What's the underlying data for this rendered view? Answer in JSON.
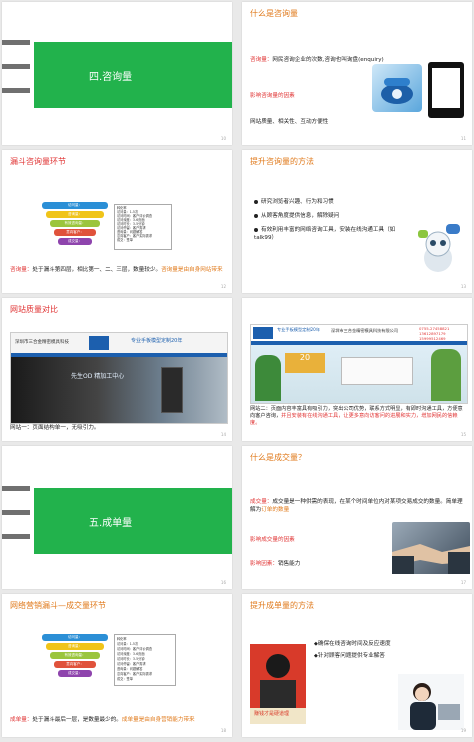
{
  "colors": {
    "orange": "#e07a1c",
    "red": "#e03434",
    "green": "#22b24c"
  },
  "s1": {
    "section": "四.咨询量",
    "page": "10"
  },
  "s2": {
    "title": "什么是咨询量",
    "term": "咨询量：",
    "definition": "网民咨询企业的次数,咨询也叫询盘(enquiry)",
    "factors_title": "影响咨询量的因素",
    "factors": "网站质量、相关性、互动方便性",
    "page": "11"
  },
  "s3": {
    "title": "漏斗咨询量环节",
    "funnel": [
      "访问量：",
      "咨询量：",
      "有效咨询量：",
      "意向客户：",
      "成交量："
    ],
    "legend": [
      "转化率",
      "访问量：1-5次",
      "访问时间：客户评价调查",
      "访问深度：3-6页面",
      "访问时长：3-5分钟",
      "访问停留：客户需求",
      "咨询量：问题解答",
      "意向客户：客户实际需求",
      "成交：签单"
    ],
    "note_red": "咨询量：",
    "note_black": "处于漏斗第四层，相比第一、二、三层，数量较少。",
    "note_orange": "咨询量是由自身网站带来",
    "page": "12"
  },
  "s4": {
    "title": "提升咨询量的方法",
    "items": [
      "研究浏览者兴趣、行为和习惯",
      "从顾客角度提供信息，解除疑问",
      "有效利用丰富的网络咨询工具，安装在线沟通工具（如talk99）"
    ],
    "page": "13"
  },
  "s5": {
    "title": "网站质量对比",
    "company": "深圳市三合金精密模具科技",
    "slogan": "专业手板模型定制20年",
    "banner": "先生OD 精加工中心",
    "caption": "网站一：页面结构单一，无吸引力。",
    "page": "14"
  },
  "s6": {
    "company": "深圳市三合金精密模具科技有限公司",
    "slogan": "专业手板模型定制20年",
    "phone1": "0755-27458821",
    "phone2": "13612897179",
    "phone3": "15999512469",
    "caption_a": "网站二：页面内容丰富具有吸引力，突出公司优势，联系方式明显，有即时沟通工具，方便意向客户咨询，",
    "caption_b": "并且安装有在线沟通工具，让更多意向访客问的进展和实力，增加网民的信赖度。",
    "page": "15"
  },
  "s7": {
    "section": "五.成单量",
    "page": "16"
  },
  "s8": {
    "title": "什么是成交量？",
    "term": "成交量：",
    "definition_a": "成交量是一种供需的表现，在某个时间单位内对某项交易成交的数量。简单理解为",
    "definition_b": "订单的数量",
    "factors_title": "影响成交量的因素",
    "factors_label": "影响因素：",
    "factors": "销售能力",
    "page": "17"
  },
  "s9": {
    "title": "网络营销漏斗—成交量环节",
    "note_red": "成单量：",
    "note_black": "处于漏斗最后一层，是数量最少的。",
    "note_orange": "成单量是由自身营销能力带来",
    "page": "18"
  },
  "s10": {
    "title": "提升成单量的方法",
    "items": [
      "确保在线咨询时间及反应速度",
      "针对顾客问题提供专业解答"
    ],
    "poster": "赚钱才是硬道理",
    "page": "19"
  }
}
